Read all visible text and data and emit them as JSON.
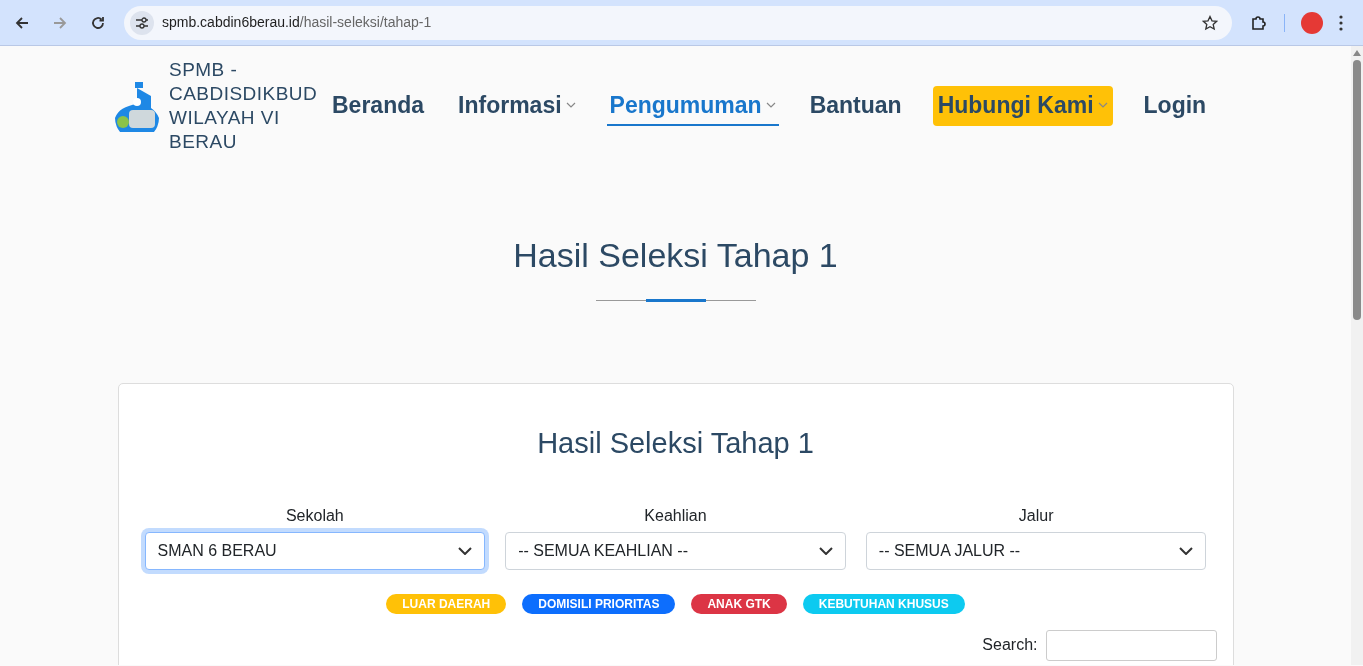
{
  "browser": {
    "url_host": "spmb.cabdin6berau.id",
    "url_path": "/hasil-seleksi/tahap-1"
  },
  "site": {
    "logo_text": "SPMB - CABDISDIKBUD WILAYAH VI BERAU"
  },
  "nav": [
    {
      "label": "Beranda",
      "dropdown": false,
      "selected": false,
      "kind": "link"
    },
    {
      "label": "Informasi",
      "dropdown": true,
      "selected": false,
      "kind": "link"
    },
    {
      "label": "Pengumuman",
      "dropdown": true,
      "selected": true,
      "kind": "link"
    },
    {
      "label": "Bantuan",
      "dropdown": false,
      "selected": false,
      "kind": "link"
    },
    {
      "label": "Hubungi Kami",
      "dropdown": true,
      "selected": false,
      "kind": "highlight"
    },
    {
      "label": "Login",
      "dropdown": false,
      "selected": false,
      "kind": "link"
    }
  ],
  "page_title": "Hasil Seleksi Tahap 1",
  "card": {
    "title": "Hasil Seleksi Tahap 1",
    "filters": [
      {
        "label": "Sekolah",
        "value": "SMAN 6 BERAU",
        "focused": true
      },
      {
        "label": "Keahlian",
        "value": "-- SEMUA KEAHLIAN --",
        "focused": false
      },
      {
        "label": "Jalur",
        "value": "-- SEMUA JALUR --",
        "focused": false
      }
    ],
    "legend": [
      {
        "label": "LUAR DAERAH",
        "color": "#ffc107"
      },
      {
        "label": "DOMISILI PRIORITAS",
        "color": "#0d6efd"
      },
      {
        "label": "ANAK GTK",
        "color": "#dc3545"
      },
      {
        "label": "KEBUTUHAN KHUSUS",
        "color": "#0dcaf0"
      }
    ],
    "search_label": "Search:"
  }
}
